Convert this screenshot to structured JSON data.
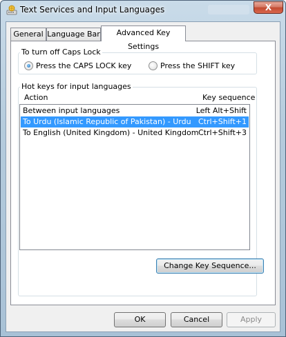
{
  "window": {
    "title": "Text Services and Input Languages",
    "icon": "keyboard-globe-icon",
    "close_glyph": "X"
  },
  "tabs": [
    {
      "label": "General"
    },
    {
      "label": "Language Bar"
    },
    {
      "label": "Advanced Key Settings",
      "active": true
    }
  ],
  "caps_lock": {
    "group_label": "To turn off Caps Lock",
    "options": [
      {
        "label": "Press the CAPS LOCK key",
        "checked": true
      },
      {
        "label": "Press the SHIFT key",
        "checked": false
      }
    ]
  },
  "hotkeys": {
    "group_label": "Hot keys for input languages",
    "col_action": "Action",
    "col_key": "Key sequence",
    "rows": [
      {
        "action": "Between input languages",
        "key": "Left Alt+Shift",
        "selected": false
      },
      {
        "action": "To Urdu (Islamic Republic of Pakistan) - Urdu",
        "key": "Ctrl+Shift+1",
        "selected": true
      },
      {
        "action": "To English (United Kingdom) - United Kingdom",
        "key": "Ctrl+Shift+3",
        "selected": false
      }
    ],
    "change_button": "Change Key Sequence..."
  },
  "footer": {
    "ok": "OK",
    "cancel": "Cancel",
    "apply": "Apply"
  },
  "colors": {
    "selection": "#3399ff",
    "close_button": "#c24a31"
  }
}
